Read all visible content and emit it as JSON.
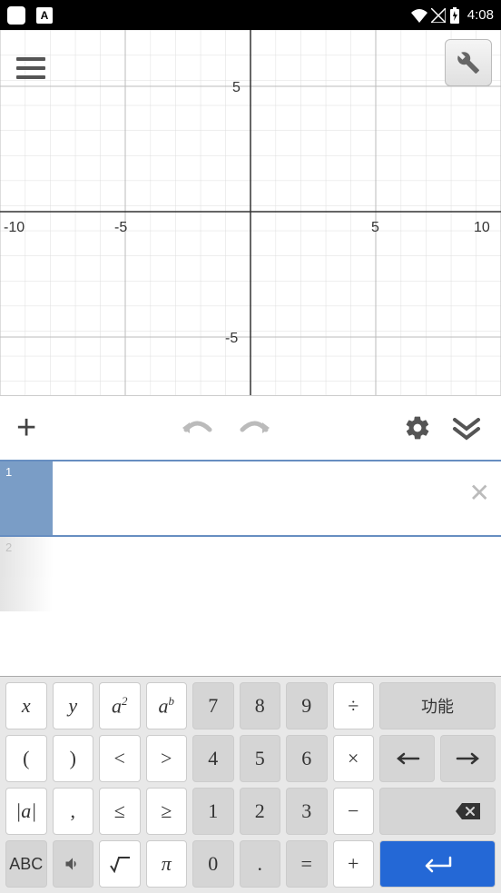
{
  "statusbar": {
    "time": "4:08",
    "a_label": "A"
  },
  "graph": {
    "x_ticks": [
      "-10",
      "-5",
      "5",
      "10"
    ],
    "y_ticks": [
      "5",
      "-5"
    ],
    "x_range": [
      -10,
      10
    ],
    "y_range": [
      -7,
      7
    ]
  },
  "toolbar": {
    "add": "+"
  },
  "input_rows": {
    "row1_num": "1",
    "row1_value": "",
    "row2_num": "2"
  },
  "keyboard": {
    "symbols": {
      "r1": [
        "x",
        "y",
        "a²",
        "aᵇ"
      ],
      "r2": [
        "(",
        ")",
        "<",
        ">"
      ],
      "r3": [
        "|a|",
        ",",
        "≤",
        "≥"
      ],
      "r4": [
        "ABC",
        "🔊",
        "√",
        "π"
      ]
    },
    "numbers": {
      "r1": [
        "7",
        "8",
        "9",
        "÷"
      ],
      "r2": [
        "4",
        "5",
        "6",
        "×"
      ],
      "r3": [
        "1",
        "2",
        "3",
        "−"
      ],
      "r4": [
        "0",
        ".",
        "=",
        "+"
      ]
    },
    "actions": {
      "functions": "功能",
      "left": "←",
      "right": "→",
      "backspace": "⌫",
      "enter": "↵"
    }
  }
}
